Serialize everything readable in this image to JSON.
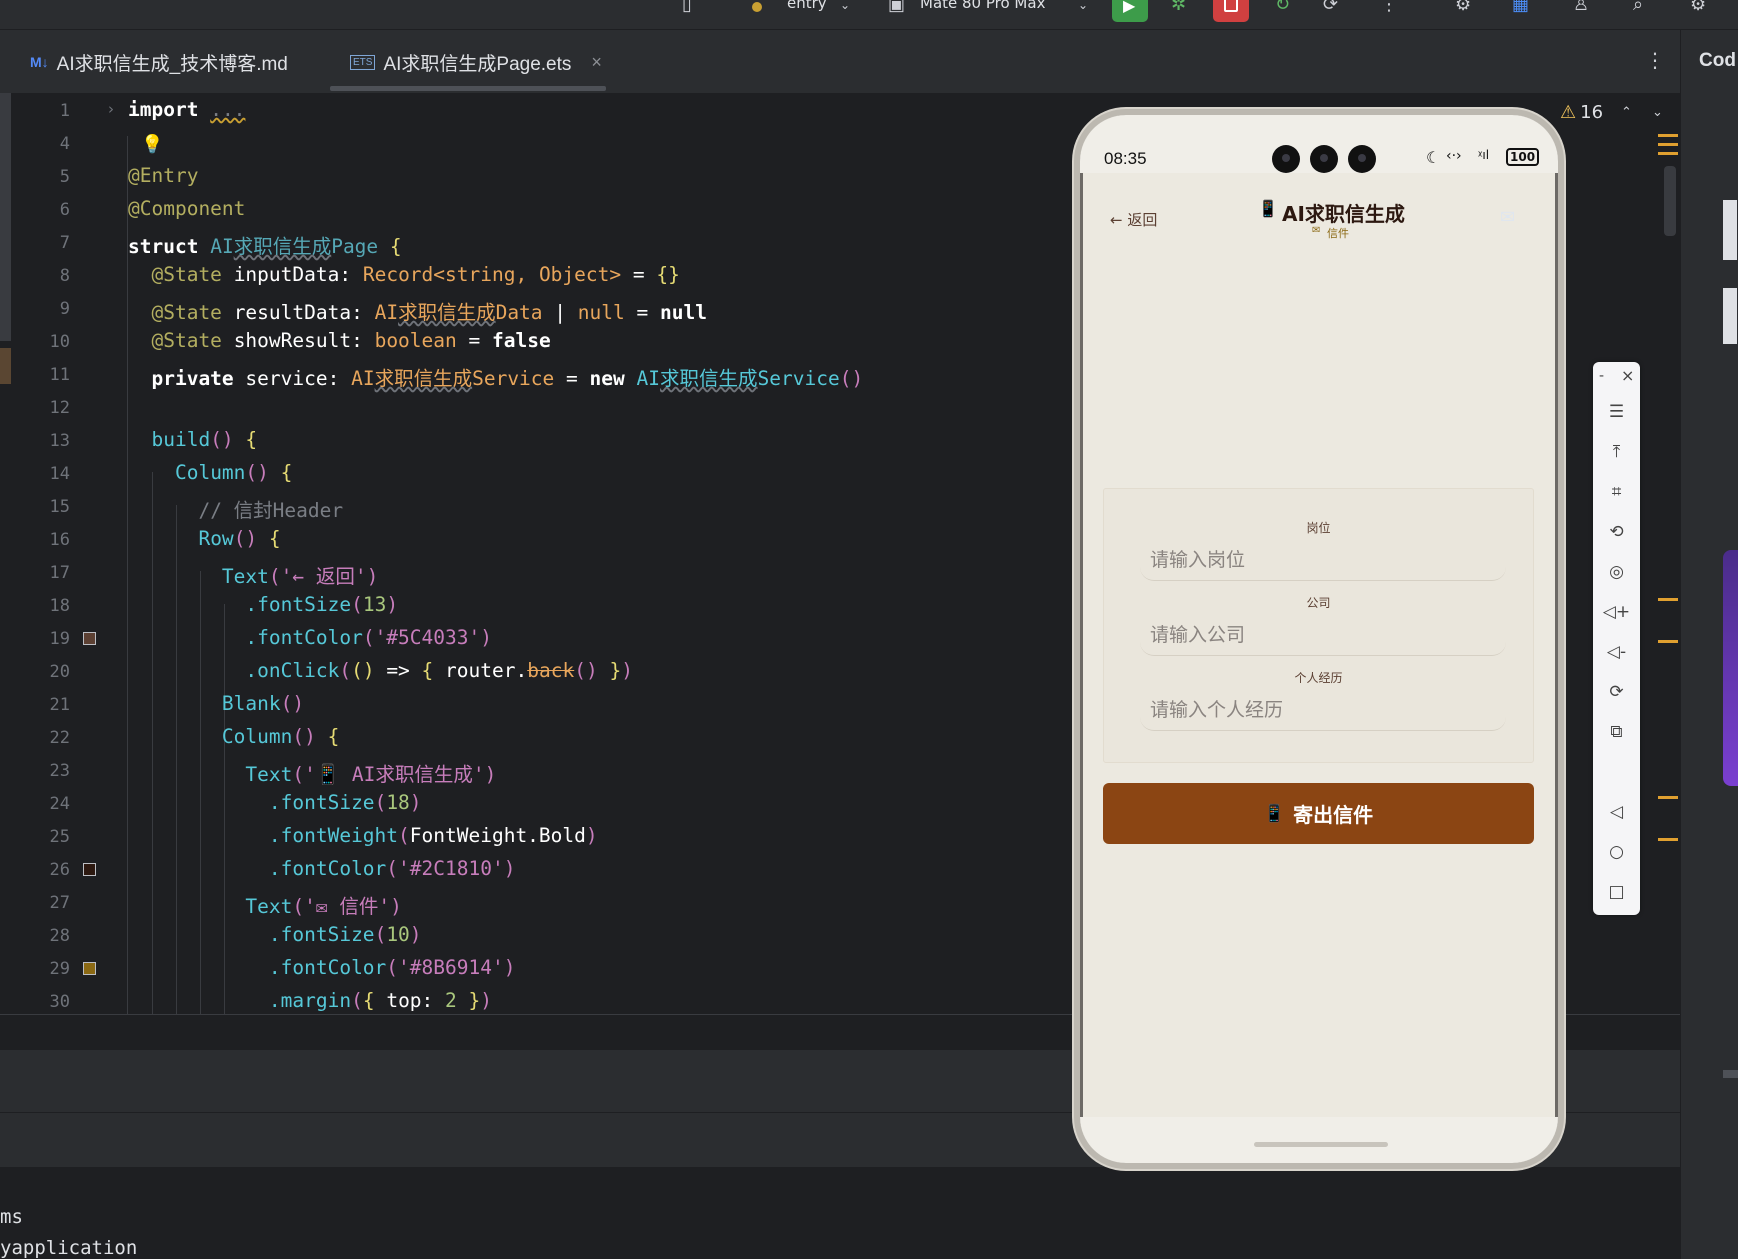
{
  "toolbar": {
    "module": "entry",
    "device": "Mate 80 Pro Max"
  },
  "tabs": [
    {
      "icon": "M↓",
      "label": "AI求职信生成_技术博客.md",
      "active": false
    },
    {
      "icon": "ETS",
      "label": "AI求职信生成Page.ets",
      "active": true
    }
  ],
  "right_panel": {
    "title": "Cod"
  },
  "editor": {
    "problems_count": "16",
    "lines": [
      {
        "num": "1",
        "text": "import ..."
      },
      {
        "num": "4",
        "text": ""
      },
      {
        "num": "5",
        "text": "@Entry"
      },
      {
        "num": "6",
        "text": "@Component"
      },
      {
        "num": "7",
        "text": "struct AI求职信生成Page {"
      },
      {
        "num": "8",
        "text": "@State inputData: Record<string, Object> = {}"
      },
      {
        "num": "9",
        "text": "@State resultData: AI求职信生成Data | null = null"
      },
      {
        "num": "10",
        "text": "@State showResult: boolean = false"
      },
      {
        "num": "11",
        "text": "private service: AI求职信生成Service = new AI求职信生成Service()"
      },
      {
        "num": "12",
        "text": ""
      },
      {
        "num": "13",
        "text": "build() {"
      },
      {
        "num": "14",
        "text": "Column() {"
      },
      {
        "num": "15",
        "text": "// 信封Header"
      },
      {
        "num": "16",
        "text": "Row() {"
      },
      {
        "num": "17",
        "text": "Text('← 返回')"
      },
      {
        "num": "18",
        "text": ".fontSize(13)"
      },
      {
        "num": "19",
        "text": ".fontColor('#5C4033')"
      },
      {
        "num": "20",
        "text": ".onClick(() => { router.back() })"
      },
      {
        "num": "21",
        "text": "Blank()"
      },
      {
        "num": "22",
        "text": "Column() {"
      },
      {
        "num": "23",
        "text": "Text('📱 AI求职信生成')"
      },
      {
        "num": "24",
        "text": ".fontSize(18)"
      },
      {
        "num": "25",
        "text": ".fontWeight(FontWeight.Bold)"
      },
      {
        "num": "26",
        "text": ".fontColor('#2C1810')"
      },
      {
        "num": "27",
        "text": "Text('✉ 信件')"
      },
      {
        "num": "28",
        "text": ".fontSize(10)"
      },
      {
        "num": "29",
        "text": ".fontColor('#8B6914')"
      },
      {
        "num": "30",
        "text": ".margin({ top: 2 })"
      }
    ]
  },
  "console": {
    "line1": "ms",
    "line2": "yapplication"
  },
  "phone": {
    "time": "08:35",
    "battery": "100",
    "back_label": "← 返回",
    "title": "AI求职信生成",
    "subtitle": "信件",
    "fields": [
      {
        "label": "岗位",
        "placeholder": "请输入岗位"
      },
      {
        "label": "公司",
        "placeholder": "请输入公司"
      },
      {
        "label": "个人经历",
        "placeholder": "请输入个人经历"
      }
    ],
    "send_label": "寄出信件"
  },
  "colors": {
    "phone_bg": "#ECE9E0",
    "send_button": "#8B4513",
    "header_text": "#5C4033",
    "title_text": "#2C1810",
    "subtitle_text": "#8B6914"
  }
}
